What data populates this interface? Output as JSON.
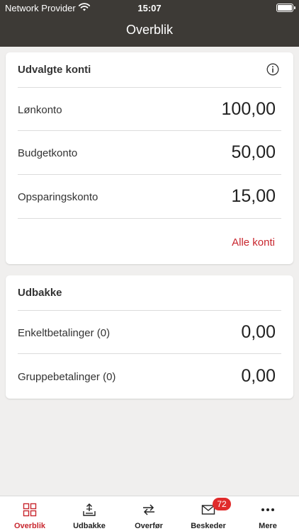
{
  "status_bar": {
    "provider": "Network Provider",
    "time": "15:07"
  },
  "nav": {
    "title": "Overblik"
  },
  "accounts": {
    "title": "Udvalgte konti",
    "rows": [
      {
        "label": "Lønkonto",
        "value": "100,00"
      },
      {
        "label": "Budgetkonto",
        "value": "50,00"
      },
      {
        "label": "Opsparingskonto",
        "value": "15,00"
      }
    ],
    "all_link": "Alle konti"
  },
  "outbox": {
    "title": "Udbakke",
    "rows": [
      {
        "label": "Enkeltbetalinger (0)",
        "value": "0,00"
      },
      {
        "label": "Gruppebetalinger (0)",
        "value": "0,00"
      }
    ]
  },
  "tabbar": {
    "items": [
      {
        "label": "Overblik",
        "icon": "grid-icon",
        "active": true
      },
      {
        "label": "Udbakke",
        "icon": "outbox-tray-icon"
      },
      {
        "label": "Overfør",
        "icon": "transfer-arrows-icon"
      },
      {
        "label": "Beskeder",
        "icon": "envelope-icon",
        "badge": "72"
      },
      {
        "label": "Mere",
        "icon": "more-dots-icon"
      }
    ]
  },
  "colors": {
    "header_bg": "#3d3a36",
    "accent": "#c8262e",
    "badge": "#e02b2b",
    "page_bg": "#f0efee"
  }
}
